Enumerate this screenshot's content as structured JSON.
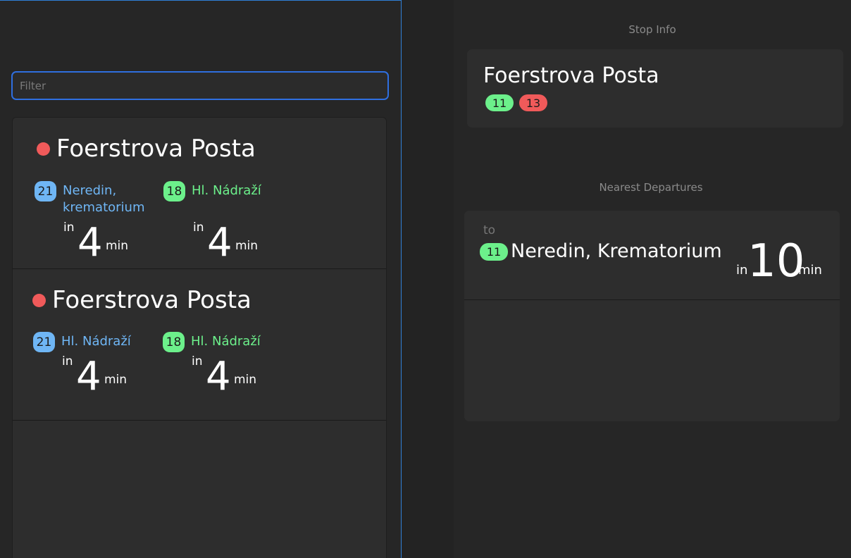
{
  "filter": {
    "placeholder": "Filter"
  },
  "stops": [
    {
      "name": "Foerstrova Posta",
      "status_color": "#f05a5a",
      "departures": [
        {
          "line": "21",
          "line_color": "#6fb6f5",
          "destination": "Neredin, krematorium",
          "prefix": "in",
          "minutes": "4",
          "unit": "min"
        },
        {
          "line": "18",
          "line_color": "#6cf08b",
          "destination": "Hl. Nádraží",
          "prefix": "in",
          "minutes": "4",
          "unit": "min"
        }
      ]
    },
    {
      "name": "Foerstrova Posta",
      "status_color": "#f05a5a",
      "departures": [
        {
          "line": "21",
          "line_color": "#6fb6f5",
          "destination": "Hl. Nádraží",
          "prefix": "in",
          "minutes": "4",
          "unit": "min"
        },
        {
          "line": "18",
          "line_color": "#6cf08b",
          "destination": "Hl. Nádraží",
          "prefix": "in",
          "minutes": "4",
          "unit": "min"
        }
      ]
    }
  ],
  "stop_info": {
    "title": "Stop Info",
    "name": "Foerstrova Posta",
    "lines": [
      {
        "number": "11",
        "color": "#6cf08b"
      },
      {
        "number": "13",
        "color": "#f05a5a"
      }
    ]
  },
  "nearest_departures": {
    "title": "Nearest Departures",
    "items": [
      {
        "to_label": "to",
        "line": "11",
        "line_color": "#6cf08b",
        "destination": "Neredin, Krematorium",
        "prefix": "in",
        "minutes": "10",
        "unit": "min"
      }
    ]
  }
}
